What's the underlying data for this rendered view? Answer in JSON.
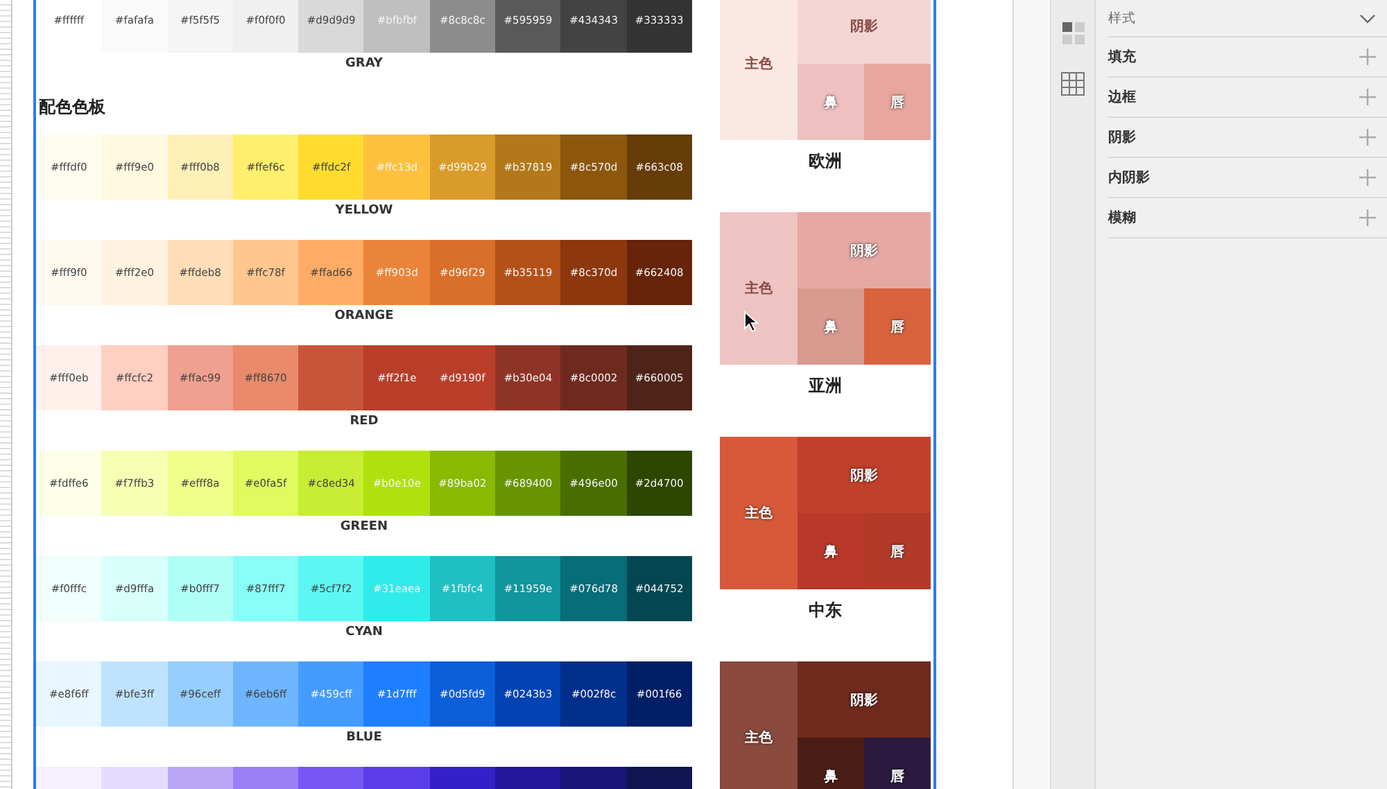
{
  "sections": [
    {
      "kind": "palette",
      "title": "GRAY",
      "swatches": [
        {
          "hex": "#ffffff",
          "color": "#ffffff",
          "inverse": false
        },
        {
          "hex": "#fafafa",
          "color": "#fafafa",
          "inverse": false
        },
        {
          "hex": "#f5f5f5",
          "color": "#f5f5f5",
          "inverse": false
        },
        {
          "hex": "#f0f0f0",
          "color": "#f0f0f0",
          "inverse": false
        },
        {
          "hex": "#d9d9d9",
          "color": "#d9d9d9",
          "inverse": false
        },
        {
          "hex": "#bfbfbf",
          "color": "#bfbfbf",
          "inverse": true
        },
        {
          "hex": "#8c8c8c",
          "color": "#8c8c8c",
          "inverse": true
        },
        {
          "hex": "#595959",
          "color": "#595959",
          "inverse": true
        },
        {
          "hex": "#434343",
          "color": "#434343",
          "inverse": true
        },
        {
          "hex": "#333333",
          "color": "#333333",
          "inverse": true
        }
      ]
    },
    {
      "kind": "heading",
      "text": "配色色板"
    },
    {
      "kind": "palette",
      "title": "YELLOW",
      "swatches": [
        {
          "hex": "#fffdf0",
          "color": "#fffdf0",
          "inverse": false
        },
        {
          "hex": "#fff9e0",
          "color": "#fff9e0",
          "inverse": false
        },
        {
          "hex": "#fff0b8",
          "color": "#fff0b8",
          "inverse": false
        },
        {
          "hex": "#ffef6c",
          "color": "#ffef6c",
          "inverse": false
        },
        {
          "hex": "#ffdc2f",
          "color": "#ffdc2f",
          "inverse": false
        },
        {
          "hex": "#ffc13d",
          "color": "#ffc13d",
          "inverse": true
        },
        {
          "hex": "#d99b29",
          "color": "#d99b29",
          "inverse": true
        },
        {
          "hex": "#b37819",
          "color": "#b37819",
          "inverse": true
        },
        {
          "hex": "#8c570d",
          "color": "#8c570d",
          "inverse": true
        },
        {
          "hex": "#663c08",
          "color": "#663c08",
          "inverse": true
        }
      ]
    },
    {
      "kind": "palette",
      "title": "ORANGE",
      "swatches": [
        {
          "hex": "#fff9f0",
          "color": "#fff9f0",
          "inverse": false
        },
        {
          "hex": "#fff2e0",
          "color": "#fff2e0",
          "inverse": false
        },
        {
          "hex": "#ffdeb8",
          "color": "#ffdeb8",
          "inverse": false
        },
        {
          "hex": "#ffc78f",
          "color": "#ffc78f",
          "inverse": false
        },
        {
          "hex": "#ffad66",
          "color": "#ffad66",
          "inverse": false
        },
        {
          "hex": "#ff903d",
          "color": "#ea8438",
          "inverse": true
        },
        {
          "hex": "#d96f29",
          "color": "#d96f29",
          "inverse": true
        },
        {
          "hex": "#b35119",
          "color": "#b35119",
          "inverse": true
        },
        {
          "hex": "#8c370d",
          "color": "#8c370d",
          "inverse": true
        },
        {
          "hex": "#662408",
          "color": "#662408",
          "inverse": true
        }
      ]
    },
    {
      "kind": "palette",
      "title": "RED",
      "swatches": [
        {
          "hex": "#fff0eb",
          "color": "#fff0eb",
          "inverse": false
        },
        {
          "hex": "#ffcfc2",
          "color": "#ffcfc2",
          "inverse": false
        },
        {
          "hex": "#ffac99",
          "color": "#f0a090",
          "inverse": false
        },
        {
          "hex": "#ff8670",
          "color": "#e98a6a",
          "inverse": false
        },
        {
          "color": "#c8553a"
        },
        {
          "hex": "#ff2f1e",
          "color": "#b93e2a",
          "inverse": true
        },
        {
          "hex": "#d9190f",
          "color": "#b93e2a",
          "inverse": true
        },
        {
          "hex": "#b30e04",
          "color": "#8e3426",
          "inverse": true
        },
        {
          "hex": "#8c0002",
          "color": "#6e2a1e",
          "inverse": true
        },
        {
          "hex": "#660005",
          "color": "#4e2419",
          "inverse": true
        }
      ]
    },
    {
      "kind": "palette",
      "title": "GREEN",
      "swatches": [
        {
          "hex": "#fdffe6",
          "color": "#fdffe6",
          "inverse": false
        },
        {
          "hex": "#f7ffb3",
          "color": "#f7ffb3",
          "inverse": false
        },
        {
          "hex": "#efff8a",
          "color": "#efff8a",
          "inverse": false
        },
        {
          "hex": "#e0fa5f",
          "color": "#e0fa5f",
          "inverse": false
        },
        {
          "hex": "#c8ed34",
          "color": "#c8ed34",
          "inverse": false
        },
        {
          "hex": "#b0e10e",
          "color": "#b0e10e",
          "inverse": true
        },
        {
          "hex": "#89ba02",
          "color": "#89ba02",
          "inverse": true
        },
        {
          "hex": "#689400",
          "color": "#689400",
          "inverse": true
        },
        {
          "hex": "#496e00",
          "color": "#496e00",
          "inverse": true
        },
        {
          "hex": "#2d4700",
          "color": "#2d4700",
          "inverse": true
        }
      ]
    },
    {
      "kind": "palette",
      "title": "CYAN",
      "swatches": [
        {
          "hex": "#f0fffc",
          "color": "#f0fffc",
          "inverse": false
        },
        {
          "hex": "#d9fffa",
          "color": "#d9fffa",
          "inverse": false
        },
        {
          "hex": "#b0fff7",
          "color": "#b0fff7",
          "inverse": false
        },
        {
          "hex": "#87fff7",
          "color": "#87fff7",
          "inverse": false
        },
        {
          "hex": "#5cf7f2",
          "color": "#5cf7f2",
          "inverse": false
        },
        {
          "hex": "#31eaea",
          "color": "#31eaea",
          "inverse": true
        },
        {
          "hex": "#1fbfc4",
          "color": "#1fbfc4",
          "inverse": true
        },
        {
          "hex": "#11959e",
          "color": "#11959e",
          "inverse": true
        },
        {
          "hex": "#076d78",
          "color": "#076d78",
          "inverse": true
        },
        {
          "hex": "#044752",
          "color": "#044752",
          "inverse": true
        }
      ]
    },
    {
      "kind": "palette",
      "title": "BLUE",
      "swatches": [
        {
          "hex": "#e8f6ff",
          "color": "#e8f6ff",
          "inverse": false
        },
        {
          "hex": "#bfe3ff",
          "color": "#bfe3ff",
          "inverse": false
        },
        {
          "hex": "#96ceff",
          "color": "#96ceff",
          "inverse": false
        },
        {
          "hex": "#6eb6ff",
          "color": "#6eb6ff",
          "inverse": false
        },
        {
          "hex": "#459cff",
          "color": "#459cff",
          "inverse": true
        },
        {
          "hex": "#1d7fff",
          "color": "#1d7fff",
          "inverse": true
        },
        {
          "hex": "#0d5fd9",
          "color": "#0d5fd9",
          "inverse": true
        },
        {
          "hex": "#0243b3",
          "color": "#0243b3",
          "inverse": true
        },
        {
          "hex": "#002f8c",
          "color": "#002f8c",
          "inverse": true
        },
        {
          "hex": "#001f66",
          "color": "#001f66",
          "inverse": true
        }
      ]
    },
    {
      "kind": "palette",
      "swatches": [
        {
          "color": "#f4f0ff"
        },
        {
          "color": "#e4dcff"
        },
        {
          "color": "#b9a6f5"
        },
        {
          "color": "#9a80f7"
        },
        {
          "color": "#7657f5"
        },
        {
          "color": "#5a3de8"
        },
        {
          "color": "#3420c8"
        },
        {
          "color": "#24179c"
        },
        {
          "color": "#1a1578"
        },
        {
          "color": "#0f1550"
        }
      ]
    }
  ],
  "cards": [
    {
      "main": {
        "label": "主色",
        "color": "#fce8e2",
        "dark_label": true
      },
      "shadow": {
        "label": "阴影",
        "color": "#f3d6d3",
        "dark_label": true
      },
      "nose": {
        "label": "鼻",
        "color": "#eec0bf"
      },
      "lip": {
        "label": "唇",
        "color": "#e9a69f"
      },
      "title": "欧洲"
    },
    {
      "main": {
        "label": "主色",
        "color": "#edc4c1",
        "dark_label": true
      },
      "shadow": {
        "label": "阴影",
        "color": "#e5a8a3"
      },
      "nose": {
        "label": "鼻",
        "color": "#d99a8f"
      },
      "lip": {
        "label": "唇",
        "color": "#d8623c"
      },
      "title": "亚洲"
    },
    {
      "main": {
        "label": "主色",
        "color": "#d65a3a"
      },
      "shadow": {
        "label": "阴影",
        "color": "#c0402c"
      },
      "nose": {
        "label": "鼻",
        "color": "#b8392a"
      },
      "lip": {
        "label": "唇",
        "color": "#b33a28"
      },
      "title": "中东"
    },
    {
      "main": {
        "label": "主色",
        "color": "#8a4a3e"
      },
      "shadow": {
        "label": "阴影",
        "color": "#6e2a1c"
      },
      "nose": {
        "label": "鼻",
        "color": "#4a1e17"
      },
      "lip": {
        "label": "唇",
        "color": "#2a1a40"
      }
    }
  ],
  "panel": {
    "header": "样式",
    "items": [
      "填充",
      "边框",
      "阴影",
      "内阴影",
      "模糊"
    ]
  }
}
